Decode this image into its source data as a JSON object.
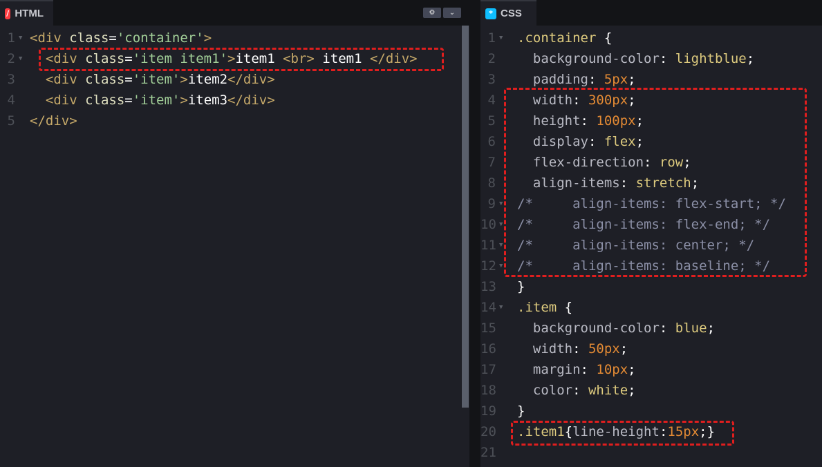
{
  "html_panel": {
    "tab_label": "HTML",
    "tab_icon": "/",
    "settings_icon": "⚙",
    "collapse_icon": "⌄",
    "lines": [
      {
        "num": "1",
        "fold": true,
        "segments": [
          {
            "t": "<div ",
            "c": "tag"
          },
          {
            "t": "class",
            "c": "attr"
          },
          {
            "t": "=",
            "c": "plain"
          },
          {
            "t": "'container'",
            "c": "str"
          },
          {
            "t": ">",
            "c": "tag"
          }
        ]
      },
      {
        "num": "2",
        "fold": true,
        "segments": [
          {
            "t": "  <div ",
            "c": "tag"
          },
          {
            "t": "class",
            "c": "attr"
          },
          {
            "t": "=",
            "c": "plain"
          },
          {
            "t": "'item item1'",
            "c": "str"
          },
          {
            "t": ">",
            "c": "tag"
          },
          {
            "t": "item1 ",
            "c": "plain"
          },
          {
            "t": "<br>",
            "c": "tag"
          },
          {
            "t": " item1 ",
            "c": "plain"
          },
          {
            "t": "</div>",
            "c": "tag"
          }
        ]
      },
      {
        "num": "3",
        "fold": false,
        "segments": [
          {
            "t": "  <div ",
            "c": "tag"
          },
          {
            "t": "class",
            "c": "attr"
          },
          {
            "t": "=",
            "c": "plain"
          },
          {
            "t": "'item'",
            "c": "str"
          },
          {
            "t": ">",
            "c": "tag"
          },
          {
            "t": "item2",
            "c": "plain"
          },
          {
            "t": "</div>",
            "c": "tag"
          }
        ]
      },
      {
        "num": "4",
        "fold": false,
        "segments": [
          {
            "t": "  <div ",
            "c": "tag"
          },
          {
            "t": "class",
            "c": "attr"
          },
          {
            "t": "=",
            "c": "plain"
          },
          {
            "t": "'item'",
            "c": "str"
          },
          {
            "t": ">",
            "c": "tag"
          },
          {
            "t": "item3",
            "c": "plain"
          },
          {
            "t": "</div>",
            "c": "tag"
          }
        ]
      },
      {
        "num": "5",
        "fold": false,
        "segments": [
          {
            "t": "</div>",
            "c": "tag"
          }
        ]
      }
    ]
  },
  "css_panel": {
    "tab_label": "CSS",
    "tab_icon": "*",
    "lines": [
      {
        "num": "1",
        "fold": true,
        "segments": [
          {
            "t": ".container",
            "c": "sel"
          },
          {
            "t": " {",
            "c": "brace"
          }
        ]
      },
      {
        "num": "2",
        "fold": false,
        "segments": [
          {
            "t": "  background-color",
            "c": "prop"
          },
          {
            "t": ": ",
            "c": "plain"
          },
          {
            "t": "lightblue",
            "c": "val"
          },
          {
            "t": ";",
            "c": "plain"
          }
        ]
      },
      {
        "num": "3",
        "fold": false,
        "segments": [
          {
            "t": "  padding",
            "c": "prop"
          },
          {
            "t": ": ",
            "c": "plain"
          },
          {
            "t": "5px",
            "c": "num"
          },
          {
            "t": ";",
            "c": "plain"
          }
        ]
      },
      {
        "num": "4",
        "fold": false,
        "segments": [
          {
            "t": "  width",
            "c": "prop"
          },
          {
            "t": ": ",
            "c": "plain"
          },
          {
            "t": "300px",
            "c": "num"
          },
          {
            "t": ";",
            "c": "plain"
          }
        ]
      },
      {
        "num": "5",
        "fold": false,
        "segments": [
          {
            "t": "  height",
            "c": "prop"
          },
          {
            "t": ": ",
            "c": "plain"
          },
          {
            "t": "100px",
            "c": "num"
          },
          {
            "t": ";",
            "c": "plain"
          }
        ]
      },
      {
        "num": "6",
        "fold": false,
        "segments": [
          {
            "t": "  display",
            "c": "prop"
          },
          {
            "t": ": ",
            "c": "plain"
          },
          {
            "t": "flex",
            "c": "val"
          },
          {
            "t": ";",
            "c": "plain"
          }
        ]
      },
      {
        "num": "7",
        "fold": false,
        "segments": [
          {
            "t": "  flex-direction",
            "c": "prop"
          },
          {
            "t": ": ",
            "c": "plain"
          },
          {
            "t": "row",
            "c": "val"
          },
          {
            "t": ";",
            "c": "plain"
          }
        ]
      },
      {
        "num": "8",
        "fold": false,
        "segments": [
          {
            "t": "  align-items",
            "c": "prop"
          },
          {
            "t": ": ",
            "c": "plain"
          },
          {
            "t": "stretch",
            "c": "val"
          },
          {
            "t": ";",
            "c": "plain"
          }
        ]
      },
      {
        "num": "9",
        "fold": true,
        "segments": [
          {
            "t": "/*     align-items: flex-start; */",
            "c": "comment"
          }
        ]
      },
      {
        "num": "10",
        "fold": true,
        "segments": [
          {
            "t": "/*     align-items: flex-end; */",
            "c": "comment"
          }
        ]
      },
      {
        "num": "11",
        "fold": true,
        "segments": [
          {
            "t": "/*     align-items: center; */",
            "c": "comment"
          }
        ]
      },
      {
        "num": "12",
        "fold": true,
        "segments": [
          {
            "t": "/*     align-items: baseline; */",
            "c": "comment"
          }
        ]
      },
      {
        "num": "13",
        "fold": false,
        "segments": [
          {
            "t": "}",
            "c": "brace"
          }
        ]
      },
      {
        "num": "14",
        "fold": true,
        "segments": [
          {
            "t": ".item",
            "c": "sel"
          },
          {
            "t": " {",
            "c": "brace"
          }
        ]
      },
      {
        "num": "15",
        "fold": false,
        "segments": [
          {
            "t": "  background-color",
            "c": "prop"
          },
          {
            "t": ": ",
            "c": "plain"
          },
          {
            "t": "blue",
            "c": "val"
          },
          {
            "t": ";",
            "c": "plain"
          }
        ]
      },
      {
        "num": "16",
        "fold": false,
        "segments": [
          {
            "t": "  width",
            "c": "prop"
          },
          {
            "t": ": ",
            "c": "plain"
          },
          {
            "t": "50px",
            "c": "num"
          },
          {
            "t": ";",
            "c": "plain"
          }
        ]
      },
      {
        "num": "17",
        "fold": false,
        "segments": [
          {
            "t": "  margin",
            "c": "prop"
          },
          {
            "t": ": ",
            "c": "plain"
          },
          {
            "t": "10px",
            "c": "num"
          },
          {
            "t": ";",
            "c": "plain"
          }
        ]
      },
      {
        "num": "18",
        "fold": false,
        "segments": [
          {
            "t": "  color",
            "c": "prop"
          },
          {
            "t": ": ",
            "c": "plain"
          },
          {
            "t": "white",
            "c": "val"
          },
          {
            "t": ";",
            "c": "plain"
          }
        ]
      },
      {
        "num": "19",
        "fold": false,
        "segments": [
          {
            "t": "}",
            "c": "brace"
          }
        ]
      },
      {
        "num": "20",
        "fold": false,
        "segments": [
          {
            "t": ".item1",
            "c": "sel"
          },
          {
            "t": "{",
            "c": "brace"
          },
          {
            "t": "line-height",
            "c": "prop"
          },
          {
            "t": ":",
            "c": "plain"
          },
          {
            "t": "15px",
            "c": "num"
          },
          {
            "t": ";}",
            "c": "brace"
          }
        ]
      },
      {
        "num": "21",
        "fold": false,
        "segments": []
      }
    ]
  },
  "colors": {
    "html_icon_bg": "#ff3c41",
    "css_icon_bg": "#0ebeff",
    "highlight": "#e01e1e"
  }
}
